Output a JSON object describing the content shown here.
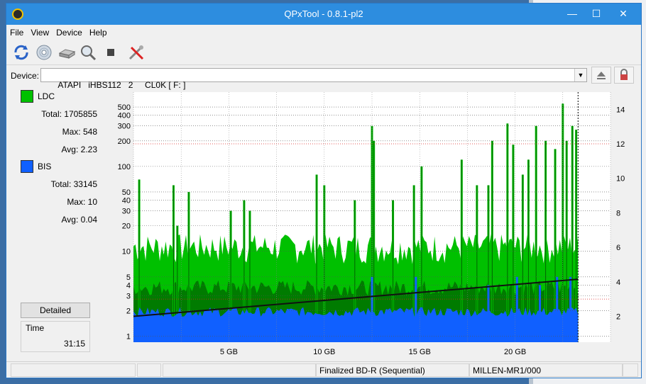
{
  "window": {
    "title": "QPxTool - 0.8.1-pl2"
  },
  "menu": [
    "File",
    "View",
    "Device",
    "Help"
  ],
  "device": {
    "label": "Device:",
    "value": "ATAPI   iHBS112   2     CL0K [ F: ]"
  },
  "legend": {
    "ldc": {
      "name": "LDC",
      "color": "#00c000",
      "total": "Total: 1705855",
      "max": "Max: 548",
      "avg": "Avg: 2.23"
    },
    "bis": {
      "name": "BIS",
      "color": "#1060ff",
      "total": "Total: 33145",
      "max": "Max: 10",
      "avg": "Avg: 0.04"
    }
  },
  "detailed_button": "Detailed",
  "time": {
    "label": "Time",
    "value": "31:15"
  },
  "status": {
    "disc_type": "Finalized BD-R (Sequential)",
    "media_id": "MILLEN-MR1/000"
  },
  "chart_data": {
    "type": "bar",
    "x_ticks": [
      "5 GB",
      "10 GB",
      "15 GB",
      "20 GB"
    ],
    "x_tick_values": [
      5,
      10,
      15,
      20
    ],
    "xlim": [
      0,
      25
    ],
    "x_end": 23.3,
    "y_left_scale": "log",
    "y_left_ticks": [
      "1",
      "2",
      "3",
      "4",
      "5",
      "10",
      "20",
      "30",
      "40",
      "50",
      "100",
      "200",
      "300",
      "400",
      "500"
    ],
    "y_left_tick_values": [
      1,
      2,
      3,
      4,
      5,
      10,
      20,
      30,
      40,
      50,
      100,
      200,
      300,
      400,
      500
    ],
    "y_left_lim": [
      0.85,
      750
    ],
    "y_right_ticks": [
      "2",
      "4",
      "6",
      "8",
      "10",
      "12",
      "14"
    ],
    "y_right_tick_values": [
      2,
      4,
      6,
      8,
      10,
      12,
      14
    ],
    "y_right_lim": [
      0.5,
      15
    ],
    "series": [
      {
        "name": "LDC",
        "color": "#00c000",
        "typical": 10,
        "max": 548,
        "avg": 2.23
      },
      {
        "name": "BIS",
        "color": "#1060ff",
        "typical": 2,
        "max": 10,
        "avg": 0.04
      }
    ],
    "ldc_spikes": [
      {
        "x": 0.3,
        "y": 70
      },
      {
        "x": 2.1,
        "y": 60
      },
      {
        "x": 2.3,
        "y": 20
      },
      {
        "x": 2.9,
        "y": 50
      },
      {
        "x": 5.1,
        "y": 30
      },
      {
        "x": 5.8,
        "y": 40
      },
      {
        "x": 6.1,
        "y": 30
      },
      {
        "x": 9.6,
        "y": 80
      },
      {
        "x": 10.0,
        "y": 60
      },
      {
        "x": 11.6,
        "y": 40
      },
      {
        "x": 12.5,
        "y": 300
      },
      {
        "x": 12.6,
        "y": 200
      },
      {
        "x": 13.6,
        "y": 40
      },
      {
        "x": 14.7,
        "y": 60
      },
      {
        "x": 15.1,
        "y": 100
      },
      {
        "x": 17.2,
        "y": 120
      },
      {
        "x": 18.0,
        "y": 60
      },
      {
        "x": 18.6,
        "y": 60
      },
      {
        "x": 18.8,
        "y": 200
      },
      {
        "x": 19.6,
        "y": 320
      },
      {
        "x": 19.9,
        "y": 180
      },
      {
        "x": 20.4,
        "y": 80
      },
      {
        "x": 20.7,
        "y": 120
      },
      {
        "x": 21.1,
        "y": 300
      },
      {
        "x": 21.6,
        "y": 200
      },
      {
        "x": 22.1,
        "y": 160
      },
      {
        "x": 22.5,
        "y": 548
      },
      {
        "x": 22.7,
        "y": 200
      },
      {
        "x": 23.0,
        "y": 300
      },
      {
        "x": 23.2,
        "y": 270
      }
    ],
    "bis_spikes": [
      {
        "x": 12.5,
        "y": 5
      },
      {
        "x": 14.8,
        "y": 5
      },
      {
        "x": 18.6,
        "y": 4
      },
      {
        "x": 20.1,
        "y": 5
      },
      {
        "x": 21.3,
        "y": 4
      },
      {
        "x": 22.2,
        "y": 5
      },
      {
        "x": 22.9,
        "y": 5
      }
    ],
    "speed_line": {
      "start": 2.0,
      "end": 4.15
    },
    "grid": true
  }
}
